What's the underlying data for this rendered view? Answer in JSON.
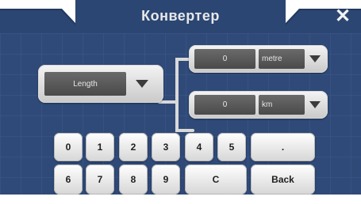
{
  "header": {
    "title": "Конвертер",
    "close_symbol": "✕"
  },
  "converter": {
    "category": "Length",
    "from": {
      "value": "0",
      "unit": "metre"
    },
    "to": {
      "value": "0",
      "unit": "km"
    }
  },
  "keypad": {
    "row1": [
      "0",
      "1",
      "2",
      "3",
      "4",
      "5",
      "."
    ],
    "row2": [
      "6",
      "7",
      "8",
      "9",
      "C",
      "Back"
    ]
  },
  "colors": {
    "background": "#2f4a78",
    "field": "#555555",
    "field_text": "#e6e6e6",
    "key_text": "#1e1e1e"
  }
}
